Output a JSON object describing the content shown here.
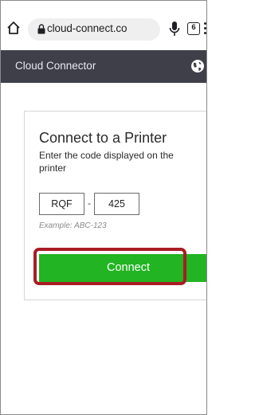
{
  "browser": {
    "url": "cloud-connect.co",
    "tab_count": "6"
  },
  "header": {
    "title": "Cloud Connector"
  },
  "card": {
    "title": "Connect to a Printer",
    "description": "Enter the code displayed on the printer",
    "code_part1": "RQF",
    "separator": "-",
    "code_part2": "425",
    "example": "Example: ABC-123",
    "connect_label": "Connect"
  },
  "colors": {
    "header_bg": "#3f3f4a",
    "connect_bg": "#22b422",
    "highlight": "#a81d24"
  }
}
